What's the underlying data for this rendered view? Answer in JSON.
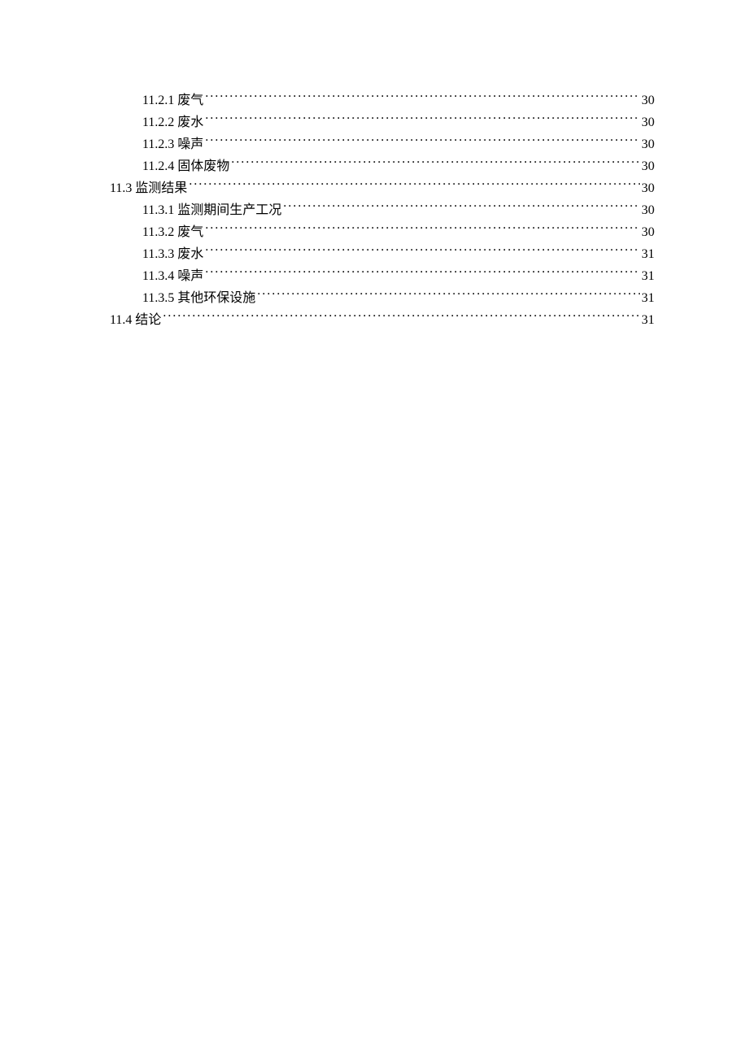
{
  "toc": [
    {
      "level": 3,
      "number": "11.2.1",
      "title": "废气",
      "page": "30"
    },
    {
      "level": 3,
      "number": "11.2.2",
      "title": "废水",
      "page": "30"
    },
    {
      "level": 3,
      "number": "11.2.3",
      "title": "噪声",
      "page": "30"
    },
    {
      "level": 3,
      "number": "11.2.4",
      "title": "固体废物",
      "page": "30"
    },
    {
      "level": 2,
      "number": "11.3",
      "title": "监测结果",
      "page": "30"
    },
    {
      "level": 3,
      "number": "11.3.1",
      "title": "监测期间生产工况",
      "page": "30"
    },
    {
      "level": 3,
      "number": "11.3.2",
      "title": "废气",
      "page": "30"
    },
    {
      "level": 3,
      "number": "11.3.3",
      "title": "废水",
      "page": "31"
    },
    {
      "level": 3,
      "number": "11.3.4",
      "title": "噪声",
      "page": "31"
    },
    {
      "level": 3,
      "number": "11.3.5",
      "title": "其他环保设施",
      "page": "31"
    },
    {
      "level": 2,
      "number": "11.4",
      "title": "结论",
      "page": "31"
    }
  ]
}
